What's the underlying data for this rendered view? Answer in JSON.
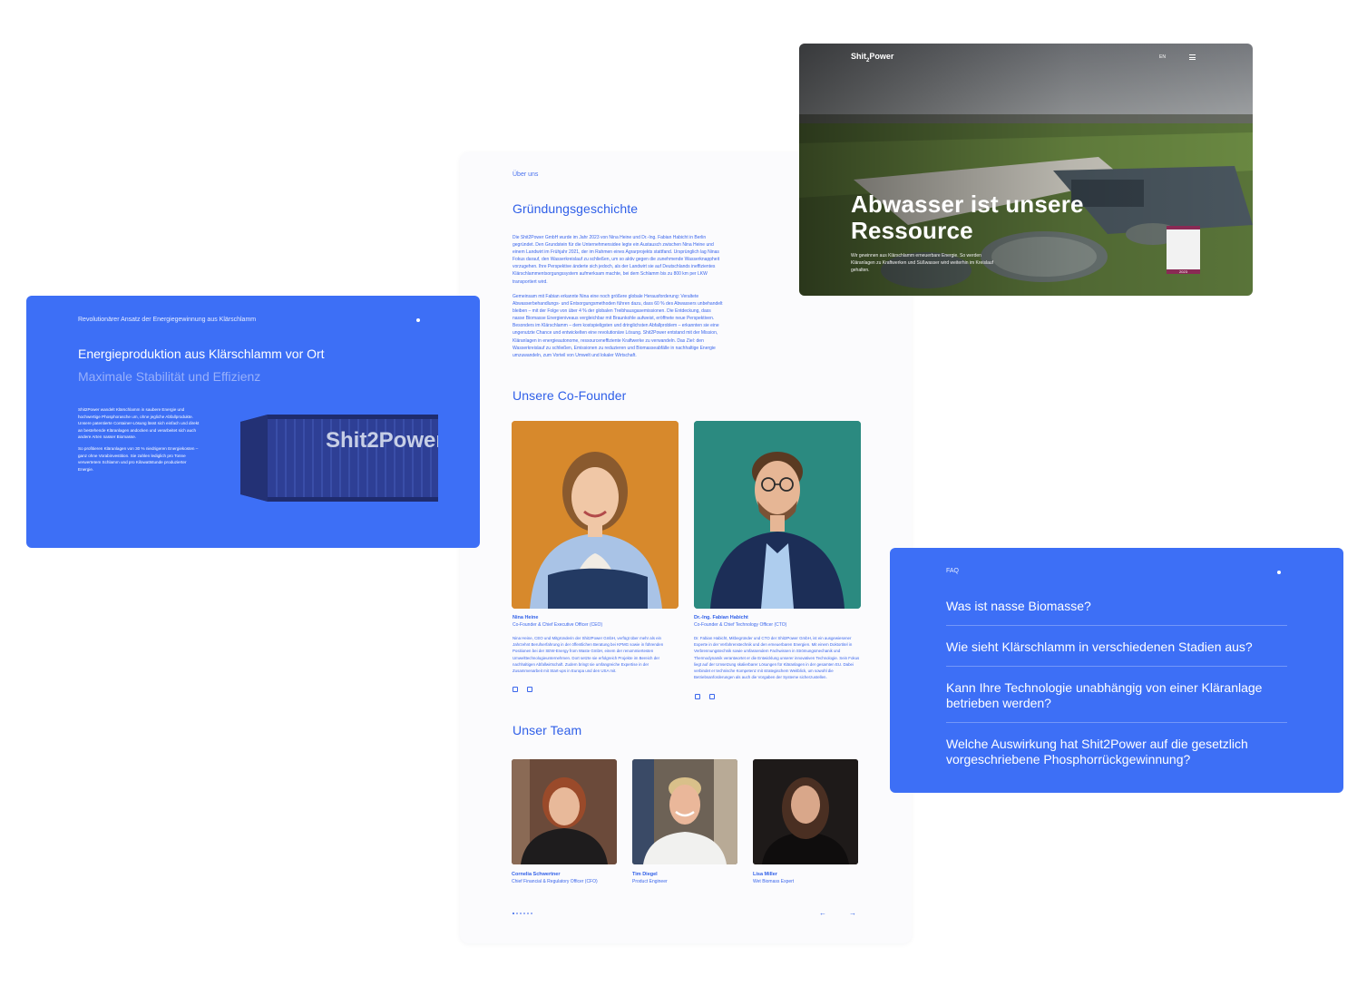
{
  "about": {
    "eyebrow": "Über uns",
    "story_heading": "Gründungsgeschichte",
    "story_p1": "Die Shit2Power GmbH wurde im Jahr 2023 von Nina Heine und Dr.-Ing. Fabian Habicht in Berlin gegründet. Den Grundstein für die Unternehmensidee legte ein Austausch zwischen Nina Heine und einem Landwirt im Frühjahr 2021, der im Rahmen eines Agrarprojekts stattfand. Ursprünglich lag Ninas Fokus darauf, den Wasserkreislauf zu schließen, um so aktiv gegen die zunehmende Wasserknappheit vorzugehen. Ihre Perspektive änderte sich jedoch, als der Landwirt sie auf Deutschlands ineffizientes Klärschlammentsorgungssystem aufmerksam machte, bei dem Schlamm bis zu 800 km per LKW transportiert wird.",
    "story_p2": "Gemeinsam mit Fabian erkannte Nina eine noch größere globale Herausforderung: Veraltete Abwasserbehandlungs- und Entsorgungsmethoden führen dazu, dass 60 % des Abwassers unbehandelt bleiben – mit der Folge von über 4 % der globalen Treibhausgasemissionen. Die Entdeckung, dass nasse Biomasse Energieniveaus vergleichbar mit Braunkohle aufweist, eröffnete neue Perspektiven. Besonders im Klärschlamm – dem kostspieligsten und dringlichsten Abfallproblem – erkannten sie eine ungenutzte Chance und entwickelten eine revolutionäre Lösung. Shit2Power entstand mit der Mission, Kläranlagen in energieautonome, ressourceneffiziente Kraftwerke zu verwandeln. Das Ziel: den Wasserkreislauf zu schließen, Emissionen zu reduzieren und Biomasseabfälle in nachhaltige Energie umzuwandeln, zum Vorteil von Umwelt und lokaler Wirtschaft.",
    "cofounder_heading": "Unsere Co-Founder",
    "founders": [
      {
        "name": "Nina Heine",
        "role": "Co-Founder & Chief Executive Officer (CEO)",
        "bio": "Nina Heine, CEO und Mitgründerin der Shit2Power GmbH, verfügt über mehr als ein Jahrzehnt Berufserfahrung in der öffentlichen Beratung bei KPMG sowie in führenden Positionen bei der SEW-Energy from Waste GmbH, einem der renommiertesten Umwelttechnologieunternehmen. Dort setzte sie erfolgreich Projekte im Bereich der nachhaltigen Abfallwirtschaft. Zudem bringt sie umfangreiche Expertise in der Zusammenarbeit mit Start-ups in Europa und den USA mit."
      },
      {
        "name": "Dr.-Ing. Fabian Habicht",
        "role": "Co-Founder & Chief Technology Officer (CTO)",
        "bio": "Dr. Fabian Habicht, Mitbegründer und CTO der Shit2Power GmbH, ist ein ausgewiesener Experte in der Verfahrenstechnik und den erneuerbaren Energien. Mit einem Doktortitel in Verbrennungstechnik sowie umfassendem Fachwissen in Strömungsmechanik und Thermodynamik verantwortet er die Entwicklung unserer innovativen Technologie. Sein Fokus liegt auf der Umsetzung skalierbarer Lösungen für Kläranlagen in der gesamten EU. Dabei verbindet er technische Kompetenz mit strategischem Weitblick, um sowohl die Betriebsanforderungen als auch die Vorgaben der Systeme sicherzustellen."
      }
    ],
    "team_heading": "Unser Team",
    "team": [
      {
        "name": "Cornelia Schwertner",
        "role": "Chief Financial & Regulatory Officer (CFO)"
      },
      {
        "name": "Tim Diegel",
        "role": "Product Engineer"
      },
      {
        "name": "Lisa Miller",
        "role": "Wet Biomass Expert"
      }
    ],
    "nav_prev": "←",
    "nav_next": "→"
  },
  "energy": {
    "eyebrow": "Revolutionärer Ansatz der Energiegewinnung aus Klärschlamm",
    "title": "Energieproduktion aus Klärschlamm vor Ort",
    "subtitle": "Maximale Stabilität und Effizienz",
    "desc_1": "Shit2Power wandelt Klärschlamm in saubere Energie und hochwertige Phosphorasche um, ohne jegliche Abfallprodukte. Unsere patentierte Container-Lösung lässt sich einfach und direkt an bestehende Kläranlagen andocken und verarbeitet sich auch andere Arten nasser Biomasse.",
    "desc_2": "So profitieren Kläranlagen von 30 % niedrigeren Energiekosten – ganz ohne Vorabinvestition. Sie zahlen lediglich pro Tonne verwertetem Schlamm und pro Kilowattstunde produzierter Energie.",
    "container_label": "Shit2Power"
  },
  "hero": {
    "logo": "Shit",
    "logo_sub": "2",
    "logo_tail": "Power",
    "lang": "EN",
    "headline": "Abwasser ist unsere Ressource",
    "lead": "Wir gewinnen aus Klärschlamm erneuerbare Energie. So werden Kläranlagen zu Kraftwerken und Süßwasser wird weiterhin im Kreislauf gehalten.",
    "badge_year": "2023"
  },
  "faq": {
    "eyebrow": "FAQ",
    "questions": [
      "Was ist nasse Biomasse?",
      "Wie sieht Klärschlamm in verschiedenen Stadien aus?",
      "Kann Ihre Technologie unabhängig von einer Kläranlage betrieben werden?",
      "Welche Auswirkung hat Shit2Power auf die gesetzlich vorgeschriebene Phosphorrückgewinnung?"
    ]
  },
  "colors": {
    "accent_blue": "#3d6ff6",
    "text_blue": "#2f5fe8",
    "badge_magenta": "#8a2a55"
  }
}
